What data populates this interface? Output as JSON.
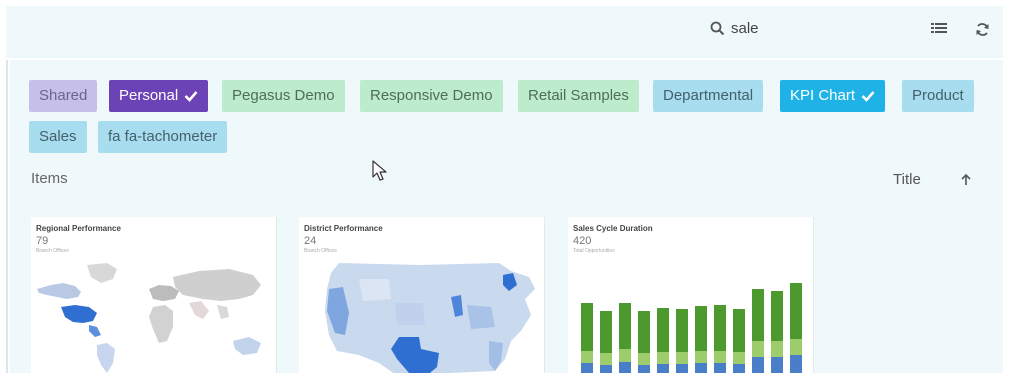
{
  "toolbar": {
    "search_value": "sale",
    "icons": [
      "search-icon",
      "list-view-icon",
      "refresh-icon"
    ]
  },
  "tags": [
    {
      "label": "Shared",
      "style": "shared",
      "checked": false
    },
    {
      "label": "Personal",
      "style": "personal",
      "checked": true
    },
    {
      "label": "Pegasus Demo",
      "style": "green",
      "checked": false
    },
    {
      "label": "Responsive Demo",
      "style": "green",
      "checked": false
    },
    {
      "label": "Retail Samples",
      "style": "green",
      "checked": false
    },
    {
      "label": "Departmental",
      "style": "blue",
      "checked": false
    },
    {
      "label": "KPI Chart",
      "style": "kpi",
      "checked": true
    },
    {
      "label": "Product",
      "style": "blue",
      "checked": false
    },
    {
      "label": "Sales",
      "style": "blue",
      "checked": false
    },
    {
      "label": "fa fa-tachometer",
      "style": "blue",
      "checked": false
    }
  ],
  "list": {
    "items_label": "Items",
    "sort_label": "Title",
    "sort_direction": "ascending"
  },
  "cards": [
    {
      "title": "Regional Performance",
      "value": "79",
      "subtitle": "Branch Offices"
    },
    {
      "title": "District Performance",
      "value": "24",
      "subtitle": "Branch Offices"
    },
    {
      "title": "Sales Cycle Duration",
      "value": "420",
      "subtitle": "Total Opportunities"
    }
  ],
  "colors": {
    "panel_bg": "#eff9fb",
    "personal": "#6c43b6",
    "kpi": "#1eb2e6",
    "green_chip": "#bdeccc",
    "blue_chip": "#a8ddf0",
    "shared_chip": "#c6c0e8"
  }
}
